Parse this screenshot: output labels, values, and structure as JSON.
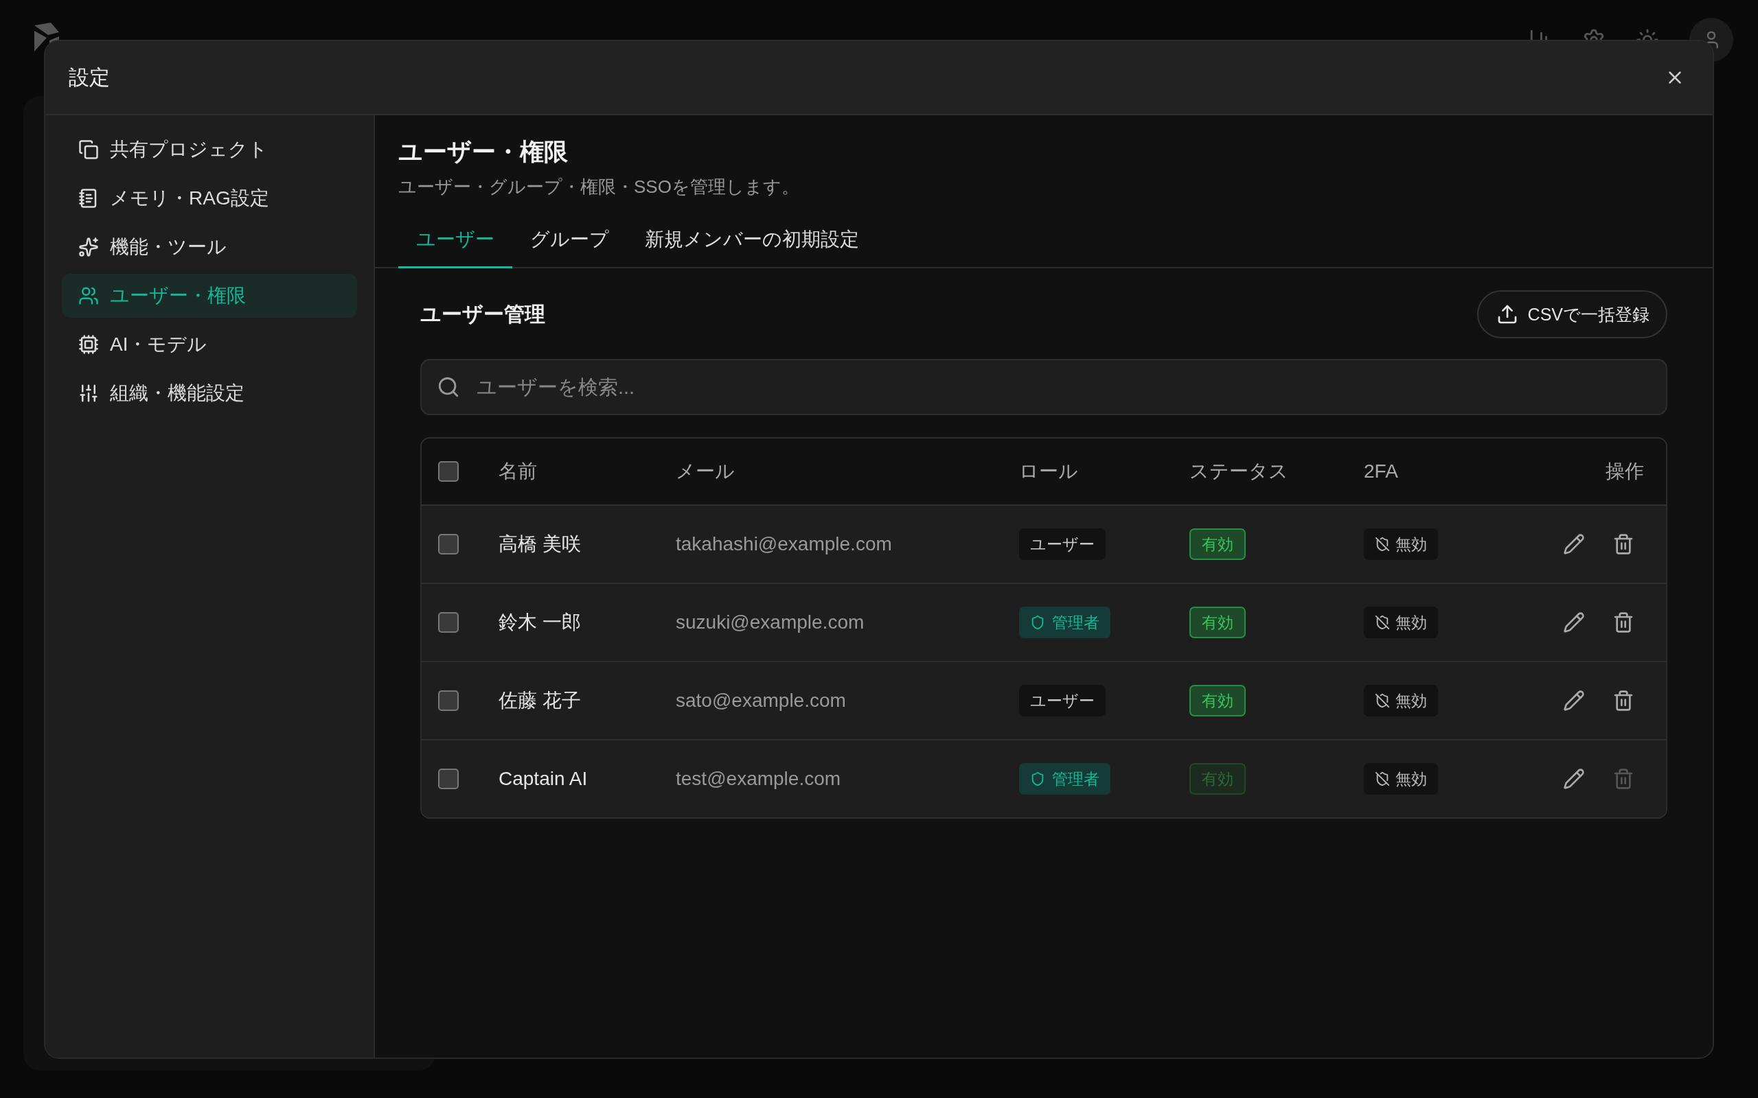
{
  "dialog": {
    "title": "設定"
  },
  "sidebar": {
    "items": [
      {
        "label": "共有プロジェクト",
        "selected": false
      },
      {
        "label": "メモリ・RAG設定",
        "selected": false
      },
      {
        "label": "機能・ツール",
        "selected": false
      },
      {
        "label": "ユーザー・権限",
        "selected": true
      },
      {
        "label": "AI・モデル",
        "selected": false
      },
      {
        "label": "組織・機能設定",
        "selected": false
      }
    ]
  },
  "page": {
    "title": "ユーザー・権限",
    "subtitle": "ユーザー・グループ・権限・SSOを管理します。"
  },
  "tabs": [
    {
      "label": "ユーザー",
      "selected": true
    },
    {
      "label": "グループ",
      "selected": false
    },
    {
      "label": "新規メンバーの初期設定",
      "selected": false
    }
  ],
  "section": {
    "title": "ユーザー管理",
    "import_button": "CSVで一括登録"
  },
  "search": {
    "placeholder": "ユーザーを検索..."
  },
  "table": {
    "select_all_checked": false,
    "columns": [
      "名前",
      "メール",
      "ロール",
      "ステータス",
      "2FA",
      "操作"
    ],
    "rows": [
      {
        "checked": false,
        "name": "高橋 美咲",
        "email": "takahashi@example.com",
        "role": {
          "kind": "user",
          "label": "ユーザー"
        },
        "status": {
          "label": "有効",
          "disabled": false
        },
        "twofa": "無効",
        "delete_disabled": false
      },
      {
        "checked": false,
        "name": "鈴木 一郎",
        "email": "suzuki@example.com",
        "role": {
          "kind": "admin",
          "label": "管理者"
        },
        "status": {
          "label": "有効",
          "disabled": false
        },
        "twofa": "無効",
        "delete_disabled": false
      },
      {
        "checked": false,
        "name": "佐藤 花子",
        "email": "sato@example.com",
        "role": {
          "kind": "user",
          "label": "ユーザー"
        },
        "status": {
          "label": "有効",
          "disabled": false
        },
        "twofa": "無効",
        "delete_disabled": false
      },
      {
        "checked": false,
        "name": "Captain AI",
        "email": "test@example.com",
        "role": {
          "kind": "admin",
          "label": "管理者"
        },
        "status": {
          "label": "有効",
          "disabled": true
        },
        "twofa": "無効",
        "delete_disabled": true
      }
    ]
  }
}
